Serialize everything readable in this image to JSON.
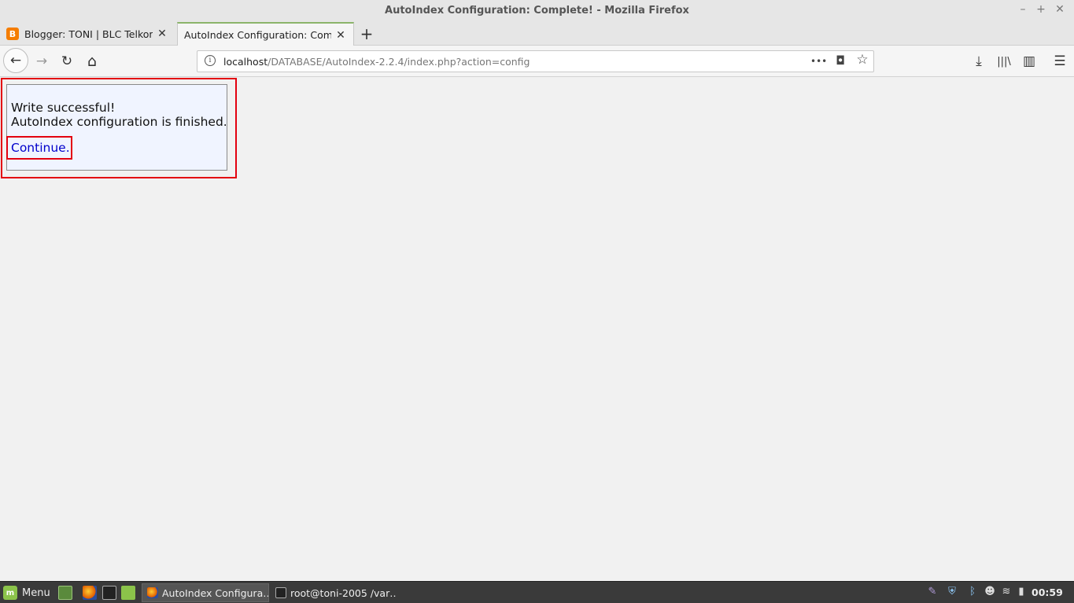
{
  "window": {
    "title": "AutoIndex Configuration: Complete! - Mozilla Firefox",
    "minimize": "–",
    "maximize": "+",
    "close": "✕"
  },
  "tabs": [
    {
      "label": "Blogger: TONI | BLC Telkom – …",
      "favicon": "B",
      "close": "✕"
    },
    {
      "label": "AutoIndex Configuration: Complete!",
      "close": "✕"
    }
  ],
  "newtab_label": "+",
  "nav": {
    "back": "←",
    "forward": "→",
    "reload": "↻",
    "home": "⌂",
    "url_host": "localhost",
    "url_path": "/DATABASE/AutoIndex-2.2.4/index.php?action=config",
    "info": "i",
    "more": "•••",
    "pocket": "◘",
    "bookmark": "☆",
    "download": "⤓",
    "library": "|||\\",
    "sidebar": "▥",
    "menu": "☰"
  },
  "content": {
    "line1": "Write successful!",
    "line2": "AutoIndex configuration is finished.",
    "continue_link": "Continue."
  },
  "taskbar": {
    "menu_label": "Menu",
    "menu_icon": "m",
    "tasks": [
      {
        "label": "AutoIndex Configura…"
      },
      {
        "label": "root@toni-2005 /var…"
      }
    ],
    "clock": "00:59",
    "tray": {
      "pen": "✎",
      "shield": "⛨",
      "bluetooth": "ᛒ",
      "user": "☻",
      "wifi": "≋",
      "battery": "▮"
    }
  }
}
